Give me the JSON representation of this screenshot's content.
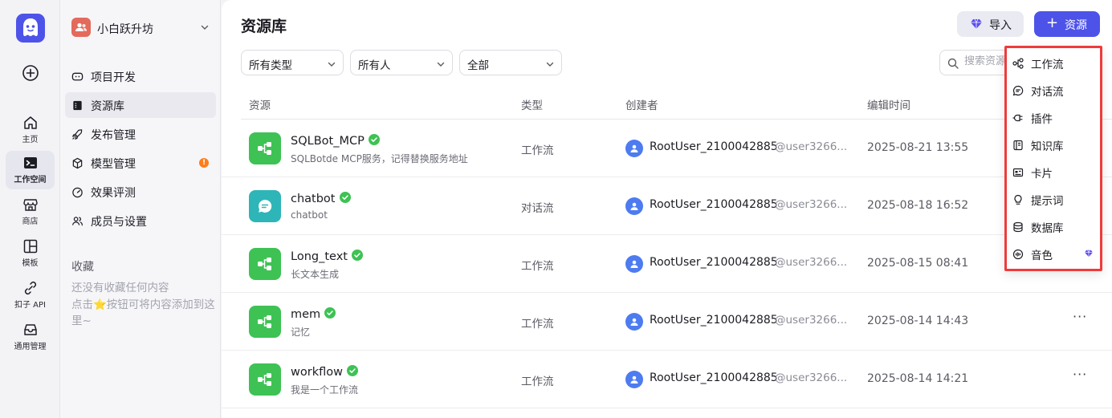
{
  "rail": {
    "items": [
      {
        "label": "主页",
        "icon": "home-icon"
      },
      {
        "label": "工作空间",
        "icon": "terminal-icon"
      },
      {
        "label": "商店",
        "icon": "store-icon"
      },
      {
        "label": "模板",
        "icon": "template-icon"
      },
      {
        "label": "扣子 API",
        "icon": "api-icon"
      },
      {
        "label": "通用管理",
        "icon": "inbox-icon"
      }
    ]
  },
  "sidebar": {
    "space_name": "小白跃升坊",
    "items": [
      {
        "label": "项目开发",
        "icon": "gamepad-icon"
      },
      {
        "label": "资源库",
        "icon": "book-icon"
      },
      {
        "label": "发布管理",
        "icon": "rocket-icon"
      },
      {
        "label": "模型管理",
        "icon": "cube-icon"
      },
      {
        "label": "效果评测",
        "icon": "gauge-icon"
      },
      {
        "label": "成员与设置",
        "icon": "users-icon"
      }
    ],
    "favorites_title": "收藏",
    "favorites_empty_1": "还没有收藏任何内容",
    "favorites_empty_2": "点击⭐按钮可将内容添加到这里~"
  },
  "main": {
    "title": "资源库",
    "import_label": "导入",
    "add_resource_label": "资源",
    "filters": {
      "type": "所有类型",
      "owner": "所有人",
      "status": "全部"
    },
    "search_placeholder": "搜索资源",
    "columns": {
      "resource": "资源",
      "type": "类型",
      "creator": "创建者",
      "edited": "编辑时间"
    },
    "rows": [
      {
        "name": "SQLBot_MCP",
        "desc": "SQLBotde MCP服务，记得替换服务地址",
        "type": "工作流",
        "user": "RootUser_2100042885",
        "handle": "@user3266...",
        "time": "2025-08-21 13:55",
        "icon": "workflow-icon"
      },
      {
        "name": "chatbot",
        "desc": "chatbot",
        "type": "对话流",
        "user": "RootUser_2100042885",
        "handle": "@user3266...",
        "time": "2025-08-18 16:52",
        "icon": "chatflow-icon"
      },
      {
        "name": "Long_text",
        "desc": "长文本生成",
        "type": "工作流",
        "user": "RootUser_2100042885",
        "handle": "@user3266...",
        "time": "2025-08-15 08:41",
        "icon": "workflow-icon"
      },
      {
        "name": "mem",
        "desc": "记忆",
        "type": "工作流",
        "user": "RootUser_2100042885",
        "handle": "@user3266...",
        "time": "2025-08-14 14:43",
        "icon": "workflow-icon"
      },
      {
        "name": "workflow",
        "desc": "我是一个工作流",
        "type": "工作流",
        "user": "RootUser_2100042885",
        "handle": "@user3266...",
        "time": "2025-08-14 14:21",
        "icon": "workflow-icon"
      }
    ]
  },
  "dropdown": {
    "items": [
      {
        "label": "工作流",
        "icon": "workflow-icon"
      },
      {
        "label": "对话流",
        "icon": "chatflow-icon"
      },
      {
        "label": "插件",
        "icon": "plugin-icon"
      },
      {
        "label": "知识库",
        "icon": "knowledge-icon"
      },
      {
        "label": "卡片",
        "icon": "card-icon"
      },
      {
        "label": "提示词",
        "icon": "prompt-icon"
      },
      {
        "label": "数据库",
        "icon": "database-icon"
      },
      {
        "label": "音色",
        "icon": "voice-icon",
        "premium": true
      }
    ]
  },
  "colors": {
    "accent": "#4d53e8",
    "success": "#3ec254",
    "highlight_border": "#ef3b3b",
    "warning": "#ff7d1a"
  }
}
